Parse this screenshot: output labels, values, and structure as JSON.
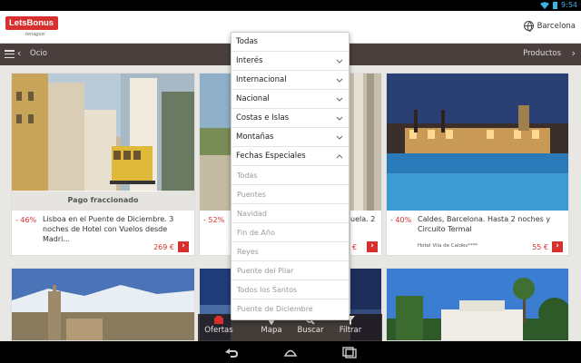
{
  "status_bar": {
    "time": "9:54",
    "icons": [
      "wifi-icon",
      "battery-icon"
    ]
  },
  "app_header": {
    "logo_text": "LetsBonus",
    "logo_sub": "tenagusi",
    "city": "Barcelona",
    "city_icon": "globe-icon"
  },
  "nav": {
    "menu_icon": "hamburger-icon",
    "back_icon": "chevron-left-icon",
    "breadcrumb": "Ocio",
    "productos": "Productos",
    "next_icon": "chevron-right-icon"
  },
  "cards": [
    {
      "discount": "- 46%",
      "title": "Lisboa en el Puente de Diciembre. 3 noches de Hotel con Vuelos desde Madri...",
      "price": "269 €",
      "overlay": "Pago fraccionado"
    },
    {
      "discount": "- 52%",
      "title": "",
      "price": ""
    },
    {
      "discount": "",
      "title": "uela. 2",
      "price": "€"
    },
    {
      "discount": "- 40%",
      "title": "Caldes, Barcelona. Hasta 2 noches y Circuito Termal",
      "price": "55 €",
      "hotel": "Hotel Vila de Caldes****"
    }
  ],
  "dropdown": {
    "items": [
      {
        "label": "Todas",
        "expandable": false
      },
      {
        "label": "Interés",
        "expandable": true
      },
      {
        "label": "Internacional",
        "expandable": true
      },
      {
        "label": "Nacional",
        "expandable": true
      },
      {
        "label": "Costas e Islas",
        "expandable": true
      },
      {
        "label": "Montañas",
        "expandable": true
      },
      {
        "label": "Fechas Especiales",
        "expandable": true,
        "expanded": true
      }
    ],
    "subitems": [
      "Todas",
      "Puentes",
      "Navidad",
      "Fin de Año",
      "Reyes",
      "Puente del Pilar",
      "Todos los Santos",
      "Puente de Diciembre"
    ]
  },
  "tabs": [
    {
      "label": "Ofertas",
      "icon": "offers-icon"
    },
    {
      "label": "Mapa",
      "icon": "map-pin-icon"
    },
    {
      "label": "Buscar",
      "icon": "search-icon"
    },
    {
      "label": "Filtrar",
      "icon": "filter-icon"
    }
  ],
  "system_nav": [
    "back-icon",
    "home-icon",
    "recents-icon"
  ],
  "colors": {
    "brand_red": "#d8302f",
    "nav_brown": "#4a3f3c",
    "status_blue": "#39b4e6"
  }
}
